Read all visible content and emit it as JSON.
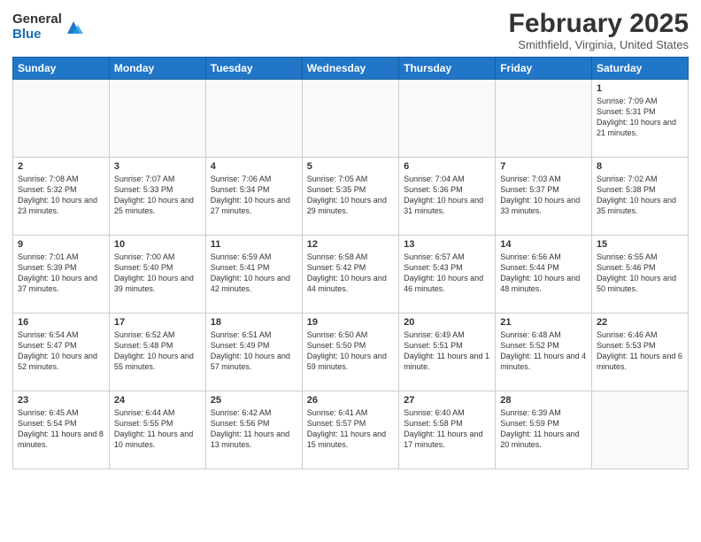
{
  "header": {
    "logo_general": "General",
    "logo_blue": "Blue",
    "month_title": "February 2025",
    "location": "Smithfield, Virginia, United States"
  },
  "days_of_week": [
    "Sunday",
    "Monday",
    "Tuesday",
    "Wednesday",
    "Thursday",
    "Friday",
    "Saturday"
  ],
  "weeks": [
    [
      {
        "day": "",
        "info": ""
      },
      {
        "day": "",
        "info": ""
      },
      {
        "day": "",
        "info": ""
      },
      {
        "day": "",
        "info": ""
      },
      {
        "day": "",
        "info": ""
      },
      {
        "day": "",
        "info": ""
      },
      {
        "day": "1",
        "info": "Sunrise: 7:09 AM\nSunset: 5:31 PM\nDaylight: 10 hours and 21 minutes."
      }
    ],
    [
      {
        "day": "2",
        "info": "Sunrise: 7:08 AM\nSunset: 5:32 PM\nDaylight: 10 hours and 23 minutes."
      },
      {
        "day": "3",
        "info": "Sunrise: 7:07 AM\nSunset: 5:33 PM\nDaylight: 10 hours and 25 minutes."
      },
      {
        "day": "4",
        "info": "Sunrise: 7:06 AM\nSunset: 5:34 PM\nDaylight: 10 hours and 27 minutes."
      },
      {
        "day": "5",
        "info": "Sunrise: 7:05 AM\nSunset: 5:35 PM\nDaylight: 10 hours and 29 minutes."
      },
      {
        "day": "6",
        "info": "Sunrise: 7:04 AM\nSunset: 5:36 PM\nDaylight: 10 hours and 31 minutes."
      },
      {
        "day": "7",
        "info": "Sunrise: 7:03 AM\nSunset: 5:37 PM\nDaylight: 10 hours and 33 minutes."
      },
      {
        "day": "8",
        "info": "Sunrise: 7:02 AM\nSunset: 5:38 PM\nDaylight: 10 hours and 35 minutes."
      }
    ],
    [
      {
        "day": "9",
        "info": "Sunrise: 7:01 AM\nSunset: 5:39 PM\nDaylight: 10 hours and 37 minutes."
      },
      {
        "day": "10",
        "info": "Sunrise: 7:00 AM\nSunset: 5:40 PM\nDaylight: 10 hours and 39 minutes."
      },
      {
        "day": "11",
        "info": "Sunrise: 6:59 AM\nSunset: 5:41 PM\nDaylight: 10 hours and 42 minutes."
      },
      {
        "day": "12",
        "info": "Sunrise: 6:58 AM\nSunset: 5:42 PM\nDaylight: 10 hours and 44 minutes."
      },
      {
        "day": "13",
        "info": "Sunrise: 6:57 AM\nSunset: 5:43 PM\nDaylight: 10 hours and 46 minutes."
      },
      {
        "day": "14",
        "info": "Sunrise: 6:56 AM\nSunset: 5:44 PM\nDaylight: 10 hours and 48 minutes."
      },
      {
        "day": "15",
        "info": "Sunrise: 6:55 AM\nSunset: 5:46 PM\nDaylight: 10 hours and 50 minutes."
      }
    ],
    [
      {
        "day": "16",
        "info": "Sunrise: 6:54 AM\nSunset: 5:47 PM\nDaylight: 10 hours and 52 minutes."
      },
      {
        "day": "17",
        "info": "Sunrise: 6:52 AM\nSunset: 5:48 PM\nDaylight: 10 hours and 55 minutes."
      },
      {
        "day": "18",
        "info": "Sunrise: 6:51 AM\nSunset: 5:49 PM\nDaylight: 10 hours and 57 minutes."
      },
      {
        "day": "19",
        "info": "Sunrise: 6:50 AM\nSunset: 5:50 PM\nDaylight: 10 hours and 59 minutes."
      },
      {
        "day": "20",
        "info": "Sunrise: 6:49 AM\nSunset: 5:51 PM\nDaylight: 11 hours and 1 minute."
      },
      {
        "day": "21",
        "info": "Sunrise: 6:48 AM\nSunset: 5:52 PM\nDaylight: 11 hours and 4 minutes."
      },
      {
        "day": "22",
        "info": "Sunrise: 6:46 AM\nSunset: 5:53 PM\nDaylight: 11 hours and 6 minutes."
      }
    ],
    [
      {
        "day": "23",
        "info": "Sunrise: 6:45 AM\nSunset: 5:54 PM\nDaylight: 11 hours and 8 minutes."
      },
      {
        "day": "24",
        "info": "Sunrise: 6:44 AM\nSunset: 5:55 PM\nDaylight: 11 hours and 10 minutes."
      },
      {
        "day": "25",
        "info": "Sunrise: 6:42 AM\nSunset: 5:56 PM\nDaylight: 11 hours and 13 minutes."
      },
      {
        "day": "26",
        "info": "Sunrise: 6:41 AM\nSunset: 5:57 PM\nDaylight: 11 hours and 15 minutes."
      },
      {
        "day": "27",
        "info": "Sunrise: 6:40 AM\nSunset: 5:58 PM\nDaylight: 11 hours and 17 minutes."
      },
      {
        "day": "28",
        "info": "Sunrise: 6:39 AM\nSunset: 5:59 PM\nDaylight: 11 hours and 20 minutes."
      },
      {
        "day": "",
        "info": ""
      }
    ]
  ]
}
